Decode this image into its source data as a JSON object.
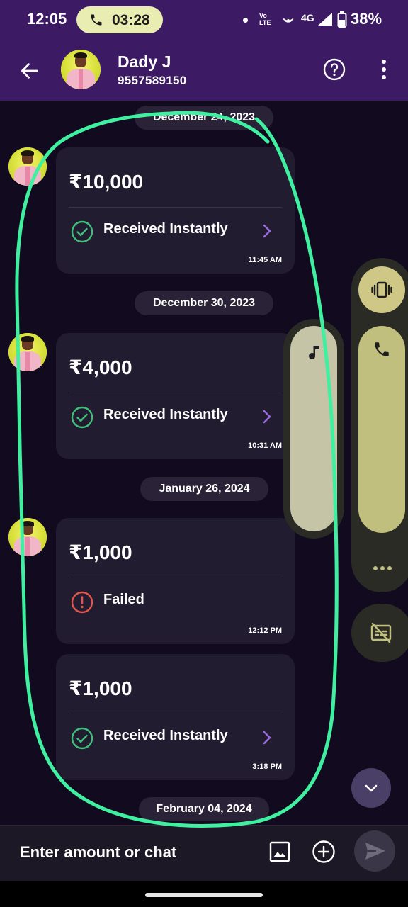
{
  "status_bar": {
    "time": "12:05",
    "call_timer": "03:28",
    "volte_label": "Vo\nLTE",
    "network": "4G",
    "battery": "38%"
  },
  "header": {
    "contact_name": "Dady J",
    "contact_phone": "9557589150"
  },
  "messages": [
    {
      "date": "December 24, 2023",
      "amount": "₹10,000",
      "status": "Received Instantly",
      "time": "11:45 AM"
    },
    {
      "date": "December 30, 2023",
      "amount": "₹4,000",
      "status": "Received Instantly",
      "time": "10:31 AM"
    },
    {
      "date": "January 26, 2024",
      "amount": "₹1,000",
      "status": "Failed",
      "time": "12:12 PM"
    },
    {
      "date": "",
      "amount": "₹1,000",
      "status": "Received Instantly",
      "time": "3:18 PM"
    }
  ],
  "next_date": "February 04, 2024",
  "composer": {
    "placeholder": "Enter amount or chat"
  },
  "colors": {
    "header_bg": "#3d1a64",
    "success": "#3fc07a",
    "failed": "#e5534b",
    "accent": "#9c6be0",
    "annotation": "#3ef0a0"
  },
  "icons": [
    "back-arrow-icon",
    "help-icon",
    "more-vert-icon",
    "check-circle-icon",
    "error-circle-icon",
    "chevron-right-icon",
    "music-note-icon",
    "vibrate-icon",
    "phone-icon",
    "more-horiz-icon",
    "captions-off-icon",
    "chevron-down-icon",
    "image-icon",
    "add-circle-icon",
    "send-icon"
  ]
}
